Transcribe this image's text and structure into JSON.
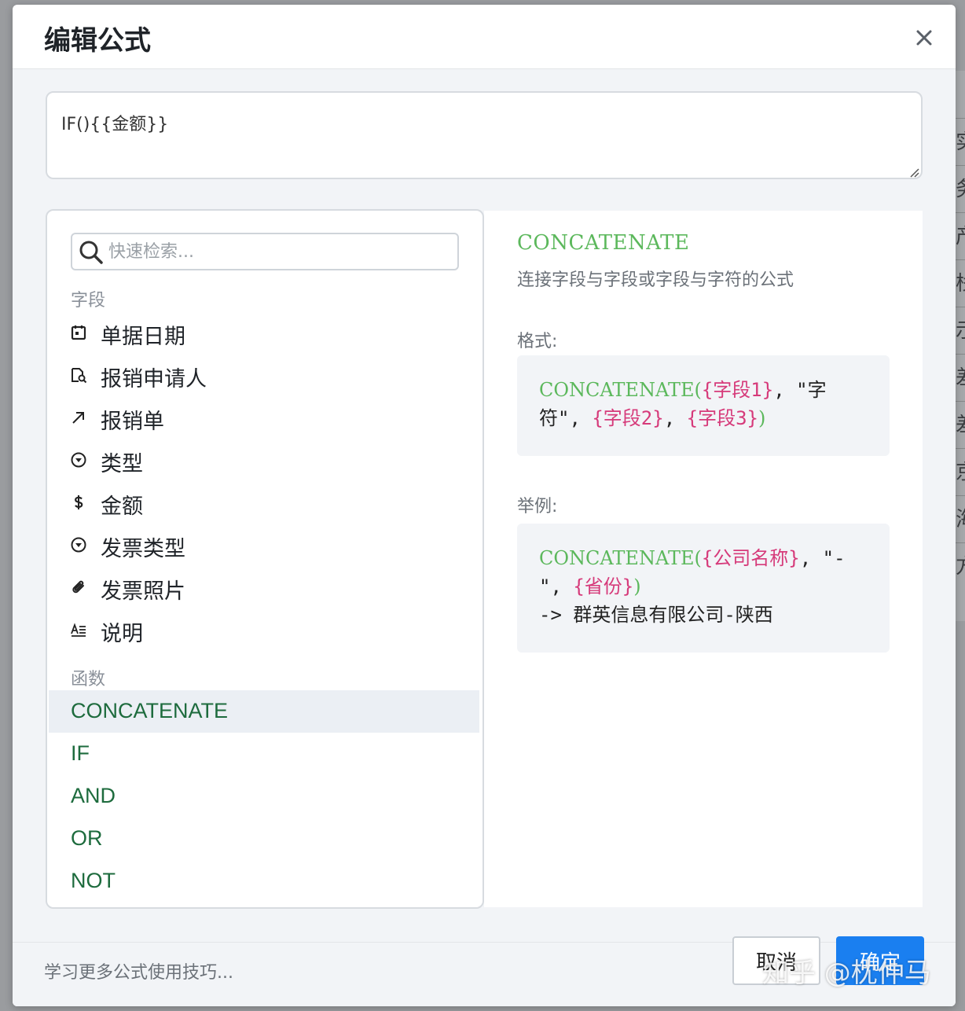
{
  "dialog": {
    "title": "编辑公式"
  },
  "formula": {
    "value": "IF(){{金额}}"
  },
  "search": {
    "placeholder": "快速检索..."
  },
  "fields": {
    "section_label": "字段",
    "items": [
      {
        "label": "单据日期",
        "icon": "calendar-icon"
      },
      {
        "label": "报销申请人",
        "icon": "user-search-icon"
      },
      {
        "label": "报销单",
        "icon": "arrow-up-right-icon"
      },
      {
        "label": "类型",
        "icon": "dropdown-circle-icon"
      },
      {
        "label": "金额",
        "icon": "dollar-icon"
      },
      {
        "label": "发票类型",
        "icon": "dropdown-circle-icon"
      },
      {
        "label": "发票照片",
        "icon": "paperclip-icon"
      },
      {
        "label": "说明",
        "icon": "text-format-icon"
      }
    ]
  },
  "functions": {
    "section_label": "函数",
    "items": [
      "CONCATENATE",
      "IF",
      "AND",
      "OR",
      "NOT"
    ],
    "selected": "CONCATENATE"
  },
  "detail": {
    "name": "CONCATENATE",
    "description": "连接字段与字段或字段与字符的公式",
    "format_label": "格式:",
    "format": {
      "fn": "CONCATENATE(",
      "arg1": "{字段1}",
      "sep1": ", \"字符\", ",
      "arg2": "{字段2}",
      "sep2": ", ",
      "arg3": "{字段3}",
      "close": ")"
    },
    "example_label": "举例:",
    "example": {
      "fn": "CONCATENATE(",
      "arg1": "{公司名称}",
      "sep1": ", \"-\", ",
      "arg2": "{省份}",
      "close": ")",
      "result": "-> 群英信息有限公司-陕西"
    }
  },
  "footer": {
    "learn_link": "学习更多公式使用技巧...",
    "cancel_label": "取消",
    "ok_label": "确定"
  },
  "watermark": "知乎 @枕仲马",
  "background": {
    "row_glyphs": [
      "实",
      "务",
      "产",
      "栈",
      "示",
      "差",
      "差",
      "京",
      "海",
      "方"
    ]
  },
  "colors": {
    "function_name": "#5cb85c",
    "argument": "#d63a7a",
    "function_list": "#1d6b3d",
    "primary_button": "#1a7ff0"
  }
}
